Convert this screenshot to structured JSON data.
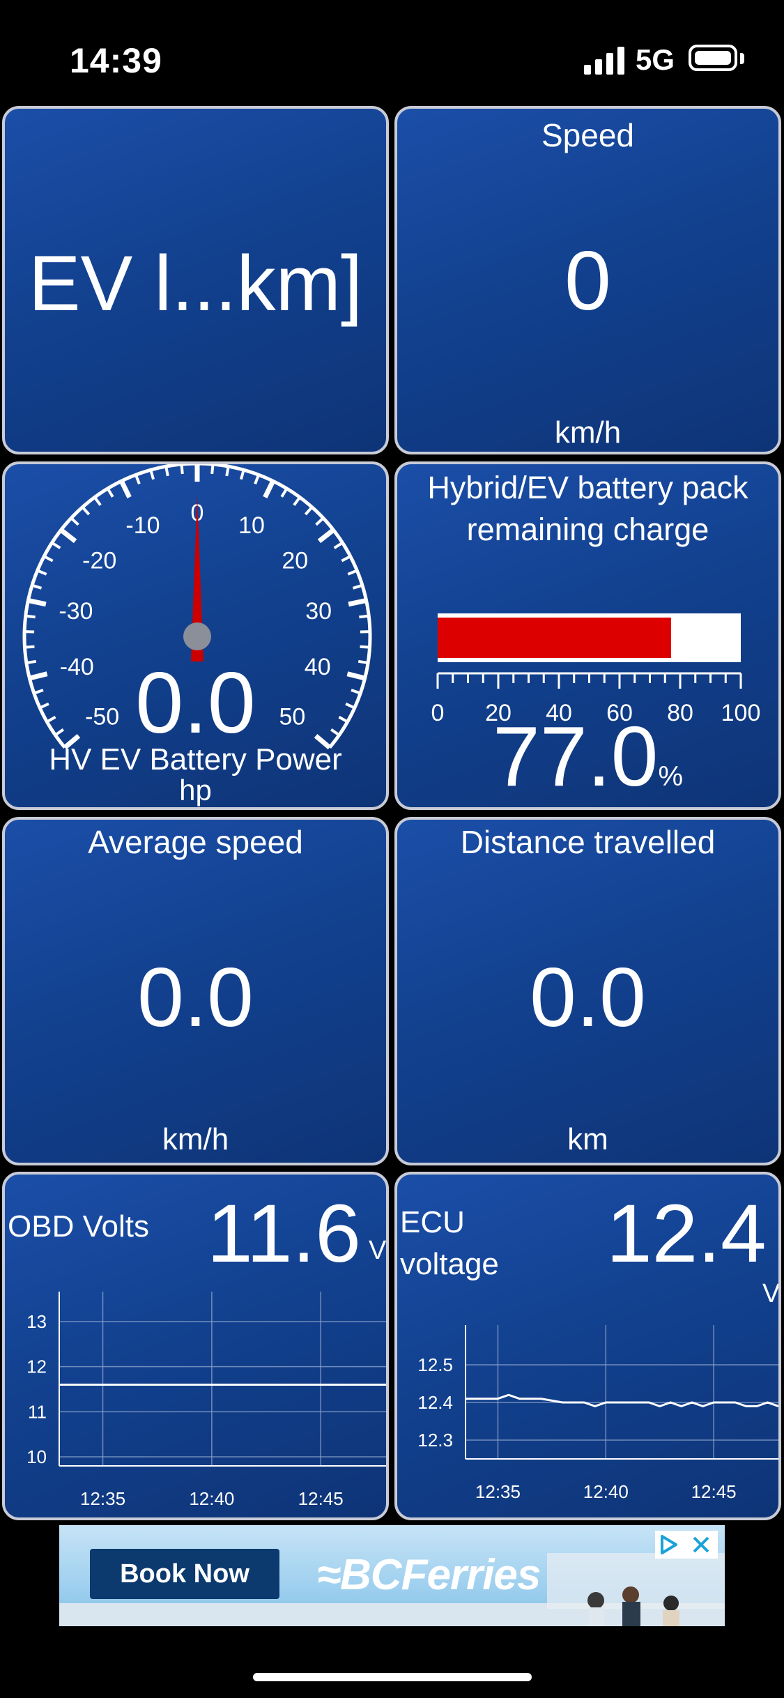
{
  "status_bar": {
    "time": "14:39",
    "network": "5G",
    "signal_icon": "cellular-signal-icon",
    "battery_icon": "battery-icon"
  },
  "tiles": {
    "ev_range": {
      "value": "EV l...km]"
    },
    "speed": {
      "title": "Speed",
      "value": "0",
      "unit": "km/h"
    },
    "battery_power": {
      "title": "HV EV Battery Power",
      "unit": "hp",
      "value": "0.0",
      "gauge": {
        "min": -50,
        "max": 50,
        "reading": 0,
        "ticks": [
          "-50",
          "-40",
          "-30",
          "-20",
          "-10",
          "0",
          "10",
          "20",
          "30",
          "40",
          "50"
        ],
        "needle_color": "#cc0000"
      }
    },
    "battery_charge": {
      "title_line1": "Hybrid/EV battery pack",
      "title_line2": "remaining charge",
      "value": "77.0",
      "unit": "%",
      "level_percent": 77,
      "bar_color": "#dd0000",
      "ticks": [
        "0",
        "20",
        "40",
        "60",
        "80",
        "100"
      ]
    },
    "avg_speed": {
      "title": "Average speed",
      "value": "0.0",
      "unit": "km/h"
    },
    "distance": {
      "title": "Distance travelled",
      "value": "0.0",
      "unit": "km"
    },
    "obd_volts": {
      "title": "OBD Volts",
      "value": "11.6",
      "unit": "V"
    },
    "ecu_voltage": {
      "title_line1": "ECU",
      "title_line2": "voltage",
      "value": "12.4",
      "unit": "V"
    }
  },
  "chart_data": [
    {
      "type": "line",
      "name": "OBD Volts",
      "x_ticks": [
        "12:35",
        "12:40",
        "12:45"
      ],
      "y_ticks": [
        "13",
        "12",
        "11",
        "10"
      ],
      "ylim": [
        9.8,
        13.2
      ],
      "x": [
        "12:33",
        "12:35",
        "12:40",
        "12:45",
        "12:48"
      ],
      "series": [
        {
          "values": [
            11.6,
            11.6,
            11.6,
            11.6,
            11.6
          ]
        }
      ]
    },
    {
      "type": "line",
      "name": "ECU voltage",
      "x_ticks": [
        "12:35",
        "12:40",
        "12:45"
      ],
      "y_ticks": [
        "12.5",
        "12.4",
        "12.3"
      ],
      "ylim": [
        12.25,
        12.55
      ],
      "x": [
        "12:33.5",
        "12:34",
        "12:35",
        "12:35.5",
        "12:36",
        "12:37",
        "12:38",
        "12:39",
        "12:39.5",
        "12:40",
        "12:41",
        "12:42",
        "12:42.5",
        "12:43",
        "12:43.5",
        "12:44",
        "12:44.5",
        "12:45",
        "12:45.5",
        "12:46",
        "12:46.5",
        "12:47",
        "12:47.5",
        "12:48"
      ],
      "series": [
        {
          "values": [
            12.41,
            12.41,
            12.41,
            12.42,
            12.41,
            12.41,
            12.4,
            12.4,
            12.39,
            12.4,
            12.4,
            12.4,
            12.39,
            12.4,
            12.39,
            12.4,
            12.39,
            12.4,
            12.4,
            12.4,
            12.39,
            12.39,
            12.4,
            12.39
          ]
        }
      ]
    }
  ],
  "ad": {
    "button": "Book Now",
    "brand": "BCFerries",
    "adchoices_icon": "adchoices-icon",
    "close_icon": "close-icon"
  }
}
